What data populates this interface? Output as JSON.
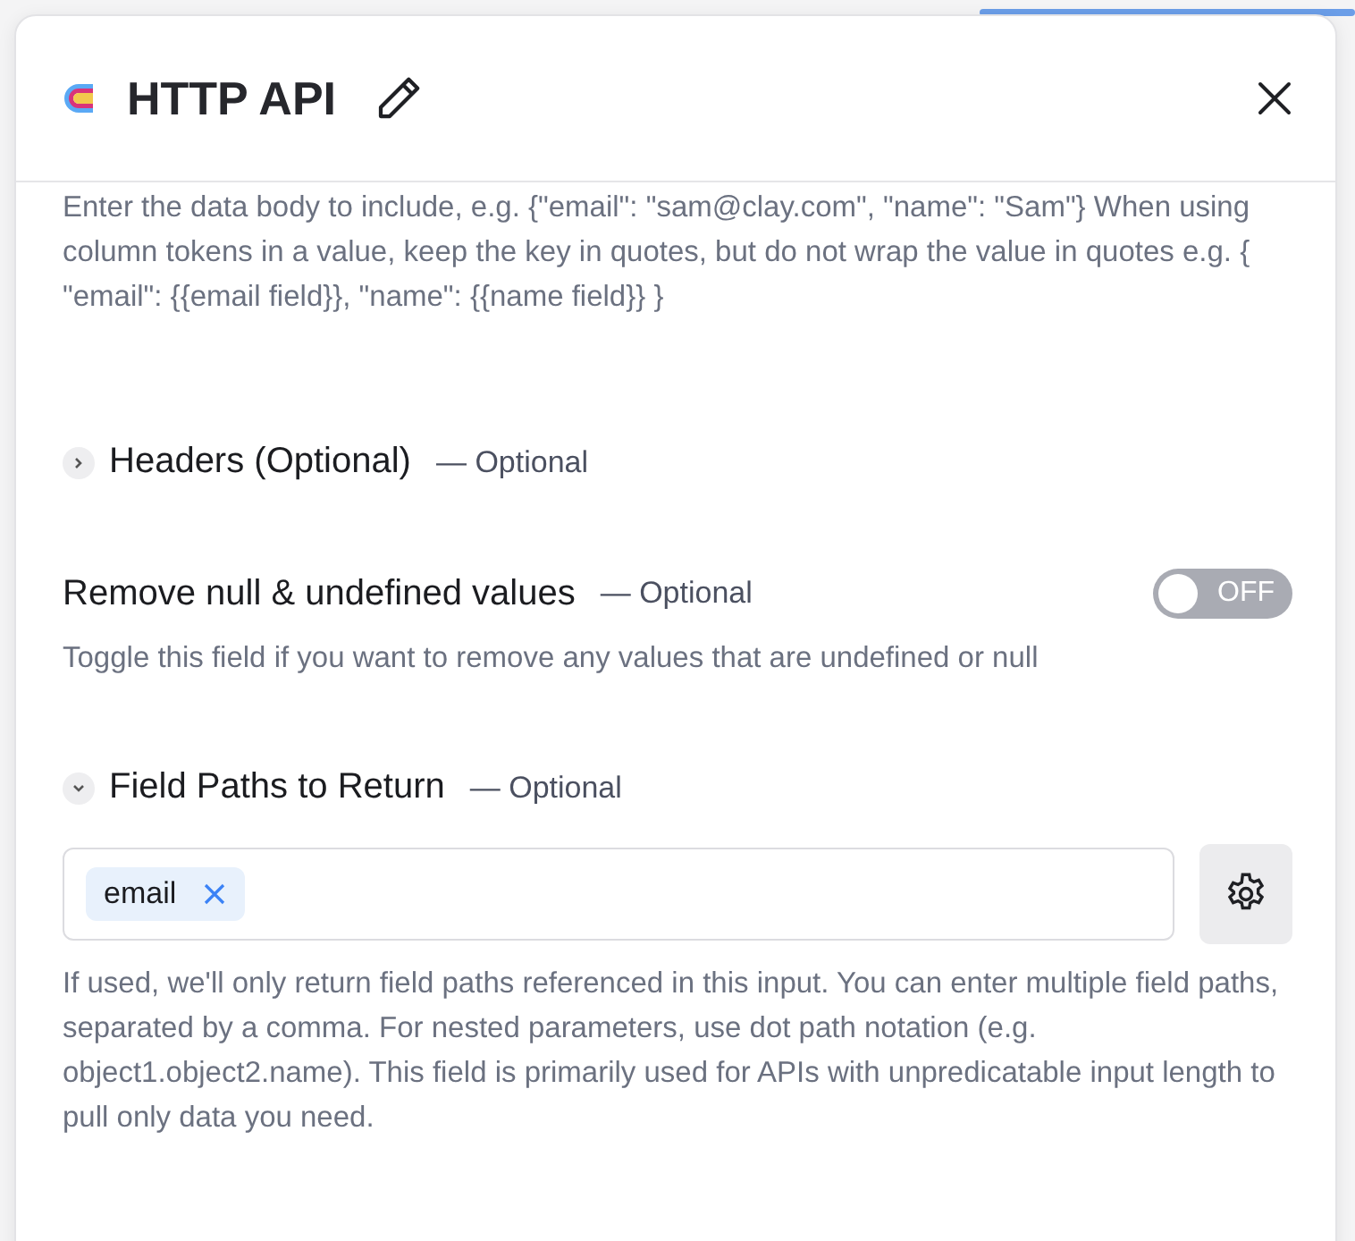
{
  "header": {
    "title": "HTTP API"
  },
  "body_description": "Enter the data body to include, e.g. {\"email\": \"sam@clay.com\", \"name\": \"Sam\"} When using column tokens in a value, keep the key in quotes, but do not wrap the value in quotes e.g. { \"email\": {{email field}}, \"name\": {{name field}} }",
  "sections": [
    {
      "kind": "collapsible",
      "title": "Headers (Optional)",
      "optional": "— Optional",
      "expanded": false
    },
    {
      "kind": "toggle",
      "title": "Remove null & undefined values",
      "optional": "— Optional",
      "on": false,
      "toggle_label": "OFF",
      "description": "Toggle this field if you want to remove any values that are undefined or null"
    },
    {
      "kind": "collapsible",
      "title": "Field Paths to Return",
      "optional": "— Optional",
      "expanded": true,
      "tags": [
        "email"
      ],
      "description": "If used, we'll only return field paths referenced in this input. You can enter multiple field paths, separated by a comma. For nested parameters, use dot path notation (e.g. object1.object2.name). This field is primarily used for APIs with unpredicatable input length to pull only data you need."
    }
  ]
}
